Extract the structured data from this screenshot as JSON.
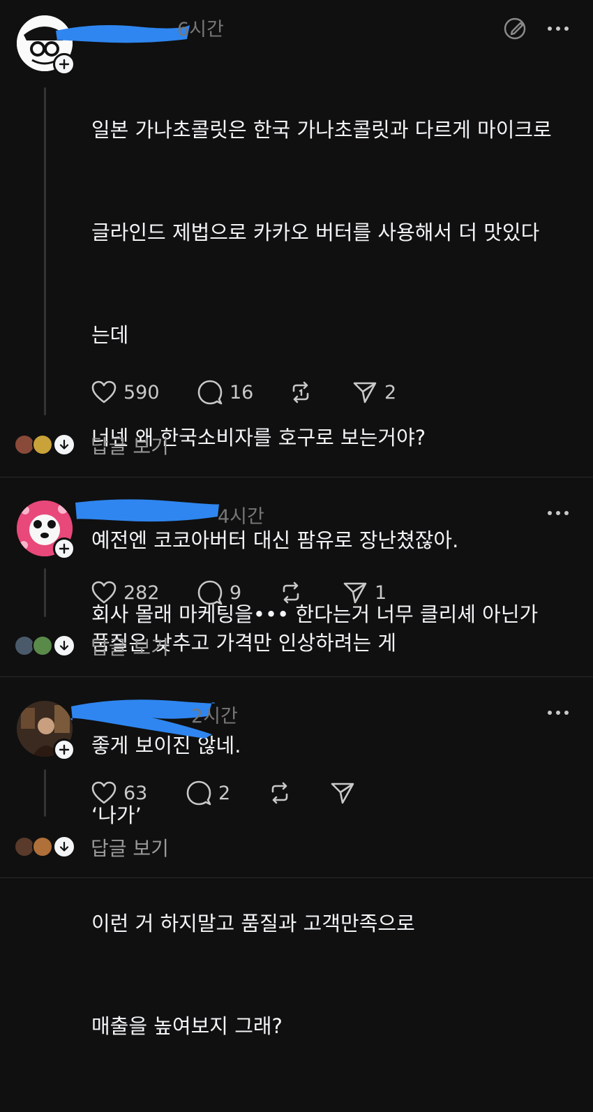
{
  "posts": [
    {
      "time": "6시간",
      "lines": [
        "일본 가나초콜릿은 한국 가나초콜릿과 다르게 마이크로",
        "글라인드 제법으로 카카오 버터를 사용해서 더 맛있다",
        "는데",
        "너넨 왜 한국소비자를 호구로 보는거야?",
        "예전엔 코코아버터 대신 팜유로 장난쳤잖아.",
        "품질은 낮추고 가격만 인상하려는 게",
        "좋게 보이진 않네.",
        "",
        "이런 거 하지말고 품질과 고객만족으로",
        "매출을 높여보지 그래?"
      ],
      "likes": "590",
      "comments": "16",
      "shares": "2",
      "replies_label": "답글 보기"
    },
    {
      "time": "4시간",
      "lines": [
        "회사 몰래 마케팅을••• 한다는거 너무 클리셰 아닌가"
      ],
      "likes": "282",
      "comments": "9",
      "shares": "1",
      "replies_label": "답글 보기"
    },
    {
      "time": "2시간",
      "lines": [
        "‘나가’"
      ],
      "likes": "63",
      "comments": "2",
      "shares": "",
      "replies_label": "답글 보기"
    }
  ],
  "colors": {
    "background": "#101010",
    "text": "#f3f5f7",
    "muted": "#777777",
    "redaction": "#2f86f0"
  }
}
